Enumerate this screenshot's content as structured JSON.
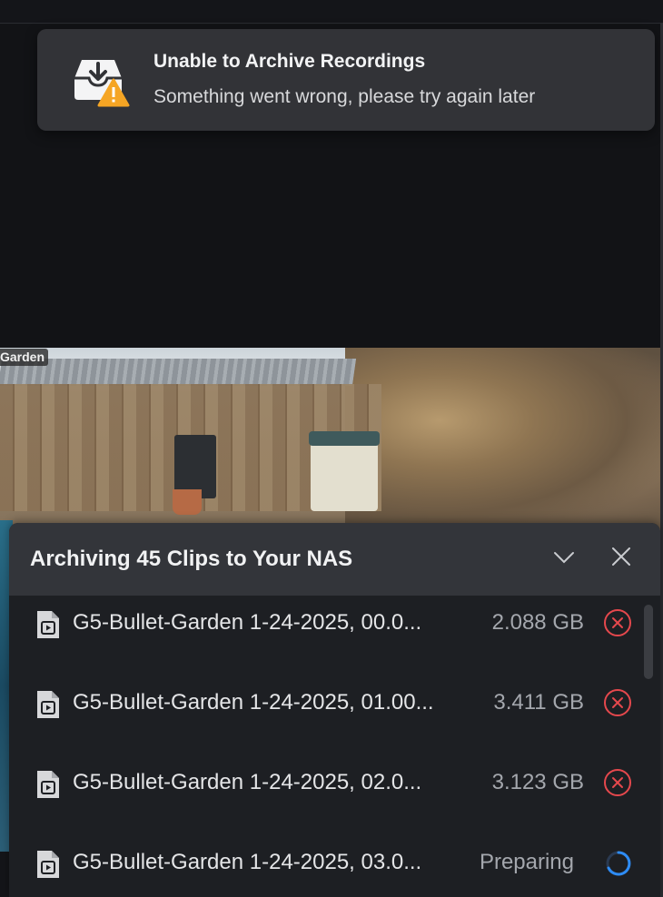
{
  "toast": {
    "title": "Unable to Archive Recordings",
    "message": "Something went wrong, please try again later",
    "icon": "archive-warning-icon"
  },
  "camera": {
    "label": "Garden"
  },
  "archive_panel": {
    "title": "Archiving 45 Clips to Your NAS",
    "items": [
      {
        "name": "G5-Bullet-Garden 1-24-2025, 00.0...",
        "size": "2.088 GB",
        "status": "failed"
      },
      {
        "name": "G5-Bullet-Garden 1-24-2025, 01.00...",
        "size": "3.411 GB",
        "status": "failed"
      },
      {
        "name": "G5-Bullet-Garden 1-24-2025, 02.0...",
        "size": "3.123 GB",
        "status": "failed"
      },
      {
        "name": "G5-Bullet-Garden 1-24-2025, 03.0...",
        "size": "Preparing",
        "status": "preparing"
      }
    ]
  },
  "colors": {
    "error_red": "#e5484d",
    "spinner_blue": "#2e8cf5",
    "warning_orange": "#f5a524"
  }
}
